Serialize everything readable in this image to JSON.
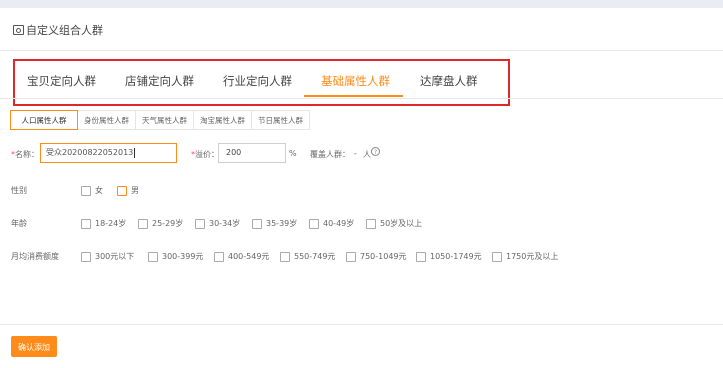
{
  "header": {
    "title": "自定义组合人群",
    "icon": "crowd-card-icon"
  },
  "main_tabs": [
    {
      "label": "宝贝定向人群",
      "active": false
    },
    {
      "label": "店铺定向人群",
      "active": false
    },
    {
      "label": "行业定向人群",
      "active": false
    },
    {
      "label": "基础属性人群",
      "active": true
    },
    {
      "label": "达摩盘人群",
      "active": false
    }
  ],
  "sub_tabs": [
    {
      "label": "人口属性人群",
      "active": true
    },
    {
      "label": "身份属性人群",
      "active": false
    },
    {
      "label": "天气属性人群",
      "active": false
    },
    {
      "label": "淘宝属性人群",
      "active": false
    },
    {
      "label": "节日属性人群",
      "active": false
    }
  ],
  "form": {
    "name_required": "*",
    "name_label": "名称：",
    "name_value": "受众20200822052013",
    "price_required": "*",
    "price_label": "溢价：",
    "price_value": "200",
    "price_unit": "%",
    "coverage_label": "覆盖人群：",
    "coverage_value": "-",
    "coverage_unit": "人",
    "help_icon": "question-circle-icon"
  },
  "gender": {
    "label": "性别",
    "options": [
      "女",
      "男"
    ]
  },
  "age": {
    "label": "年龄",
    "options": [
      "18-24岁",
      "25-29岁",
      "30-34岁",
      "35-39岁",
      "40-49岁",
      "50岁及以上"
    ]
  },
  "spend": {
    "label": "月均消费额度",
    "options": [
      "300元以下",
      "300-399元",
      "400-549元",
      "550-749元",
      "750-1049元",
      "1050-1749元",
      "1750元及以上"
    ]
  },
  "confirm_button": "确认添加",
  "colors": {
    "accent": "#ff8c1a",
    "highlight_box": "#e02828",
    "required": "#ff4d4f"
  }
}
